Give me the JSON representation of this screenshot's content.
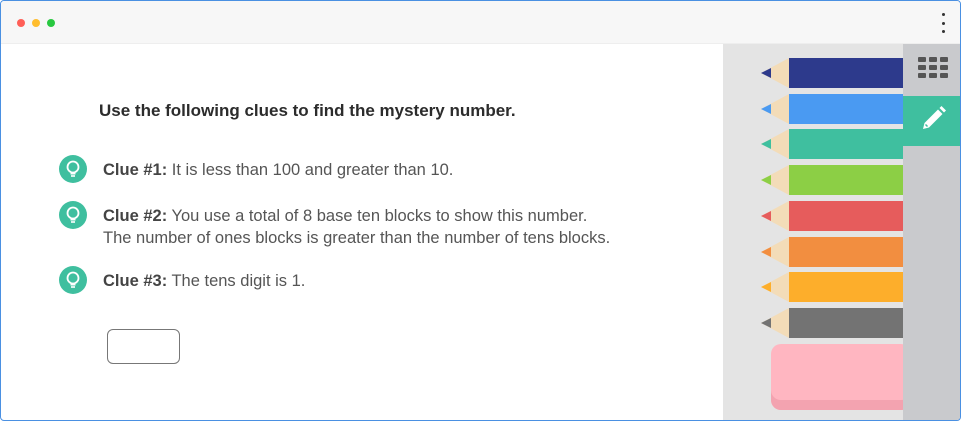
{
  "window": {
    "controls": [
      "close",
      "minimize",
      "maximize"
    ],
    "menu_icon": "kebab-vertical-icon"
  },
  "question": {
    "prompt": "Use the following clues to find the mystery number."
  },
  "clues": [
    {
      "label": "Clue #1:",
      "text": " It is less than 100 and greater than 10.",
      "icon": "lightbulb-icon"
    },
    {
      "label": "Clue #2:",
      "text": " You use a total of 8 base ten blocks to show this number.",
      "text2": "The number of ones blocks is greater than the number of tens blocks.",
      "icon": "lightbulb-icon"
    },
    {
      "label": "Clue #3:",
      "text": " The tens digit is 1.",
      "icon": "lightbulb-icon"
    }
  ],
  "answer": {
    "value": "",
    "placeholder": ""
  },
  "drawing_tray": {
    "pencils": [
      {
        "color": "#2d3a8c",
        "tip": "#2d3a8c"
      },
      {
        "color": "#4a9af2",
        "tip": "#4a9af2"
      },
      {
        "color": "#3fbf9f",
        "tip": "#3fbf9f"
      },
      {
        "color": "#8ccf45",
        "tip": "#8ccf45"
      },
      {
        "color": "#e65c5c",
        "tip": "#e65c5c"
      },
      {
        "color": "#f28e40",
        "tip": "#f28e40"
      },
      {
        "color": "#fdae2b",
        "tip": "#fdae2b"
      },
      {
        "color": "#737373",
        "tip": "#737373"
      }
    ],
    "eraser_color": "#ffb6c1"
  },
  "toolbar": {
    "tools": [
      {
        "icon": "keypad-grid-icon",
        "active": false
      },
      {
        "icon": "pencil-icon",
        "active": true
      }
    ],
    "accent": "#3fbf9f"
  }
}
